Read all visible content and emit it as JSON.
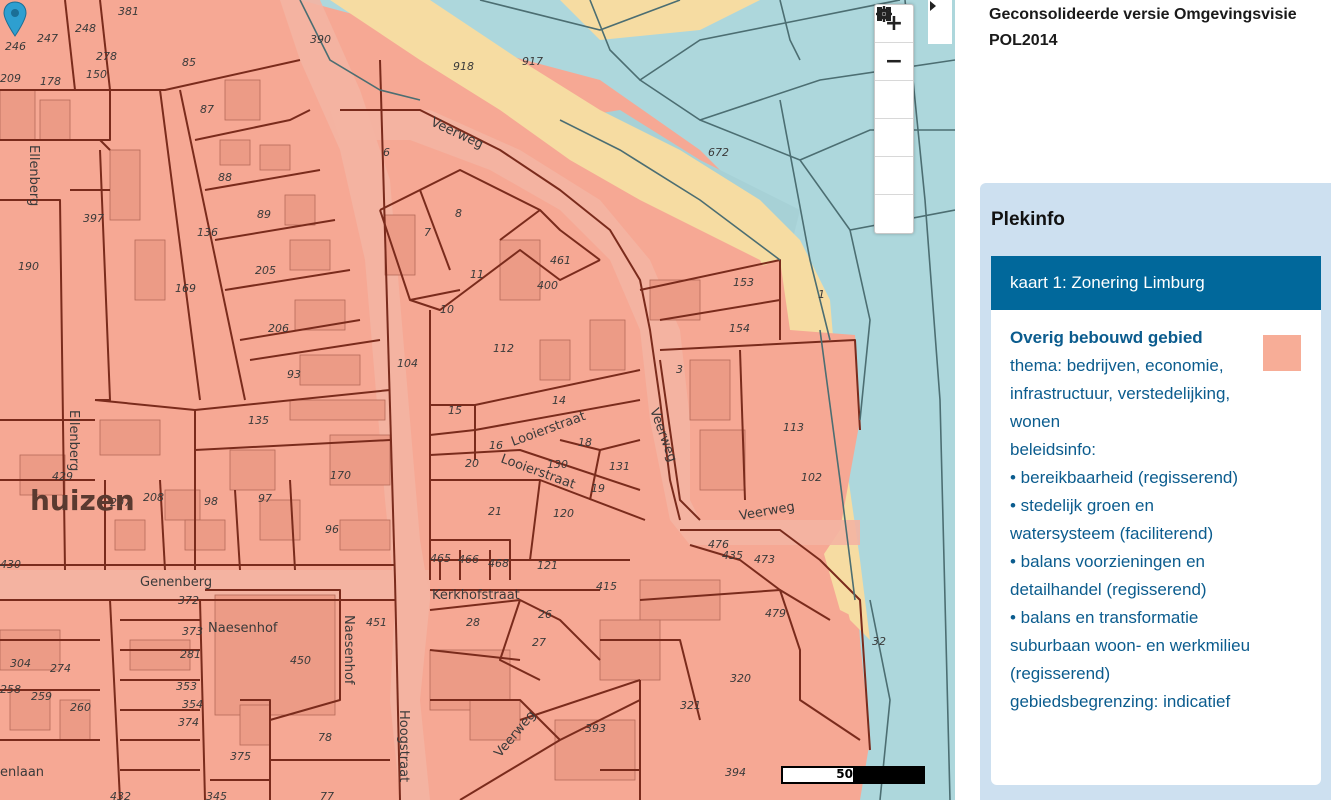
{
  "app": {
    "title": "Geconsolideerde versie Omgevingsvisie POL2014"
  },
  "map": {
    "controls": {
      "zoom_in": "+",
      "zoom_out": "−"
    },
    "scale": "50 m",
    "place_label": "huizen",
    "street_labels": [
      "Veerweg",
      "Veerweg",
      "Veerweg",
      "Veerweg",
      "Ellenberg",
      "Ellenberg",
      "Genenberg",
      "Naesenhof",
      "Naesenhof",
      "Hoogstraat",
      "Kerkhofstraat",
      "Looierstraat",
      "Looierstraat",
      "enlaan"
    ],
    "parcel_numbers": [
      "381",
      "246",
      "247",
      "248",
      "390",
      "85",
      "209",
      "178",
      "150",
      "918",
      "917",
      "87",
      "278",
      "6",
      "672",
      "88",
      "397",
      "136",
      "89",
      "8",
      "7",
      "190",
      "205",
      "461",
      "153",
      "169",
      "11",
      "400",
      "10",
      "1",
      "206",
      "154",
      "112",
      "104",
      "93",
      "3",
      "135",
      "15",
      "14",
      "18",
      "113",
      "16",
      "20",
      "170",
      "130",
      "131",
      "429",
      "21",
      "19",
      "102",
      "207",
      "208",
      "98",
      "97",
      "120",
      "96",
      "476",
      "473",
      "465",
      "466",
      "468",
      "121",
      "435",
      "430",
      "372",
      "373",
      "451",
      "415",
      "479",
      "281",
      "450",
      "304",
      "274",
      "28",
      "26",
      "353",
      "27",
      "258",
      "259",
      "260",
      "354",
      "374",
      "320",
      "321",
      "78",
      "393",
      "32",
      "375",
      "432",
      "345",
      "77",
      "394"
    ],
    "colors": {
      "bebouwd": "#f6a894",
      "water": "#add7dc",
      "sand": "#f6dca2",
      "parcel_line": "#7a2b1c",
      "pin": "#2e9fd0"
    }
  },
  "panel": {
    "title": "Plekinfo",
    "card_header": "kaart 1: Zonering Limburg",
    "zone_name": "Overig bebouwd gebied",
    "lines": [
      "thema: bedrijven, economie, infrastructuur, verstedelijking, wonen",
      "beleidsinfo:",
      "• bereikbaarheid (regisserend)",
      "• stedelijk groen en watersysteem (faciliterend)",
      "• balans voorzieningen en detailhandel (regisserend)",
      "• balans en transformatie suburbaan woon- en werkmilieu (regisserend)",
      "gebiedsbegrenzing: indicatief"
    ],
    "swatch_color": "#f7ad97"
  }
}
